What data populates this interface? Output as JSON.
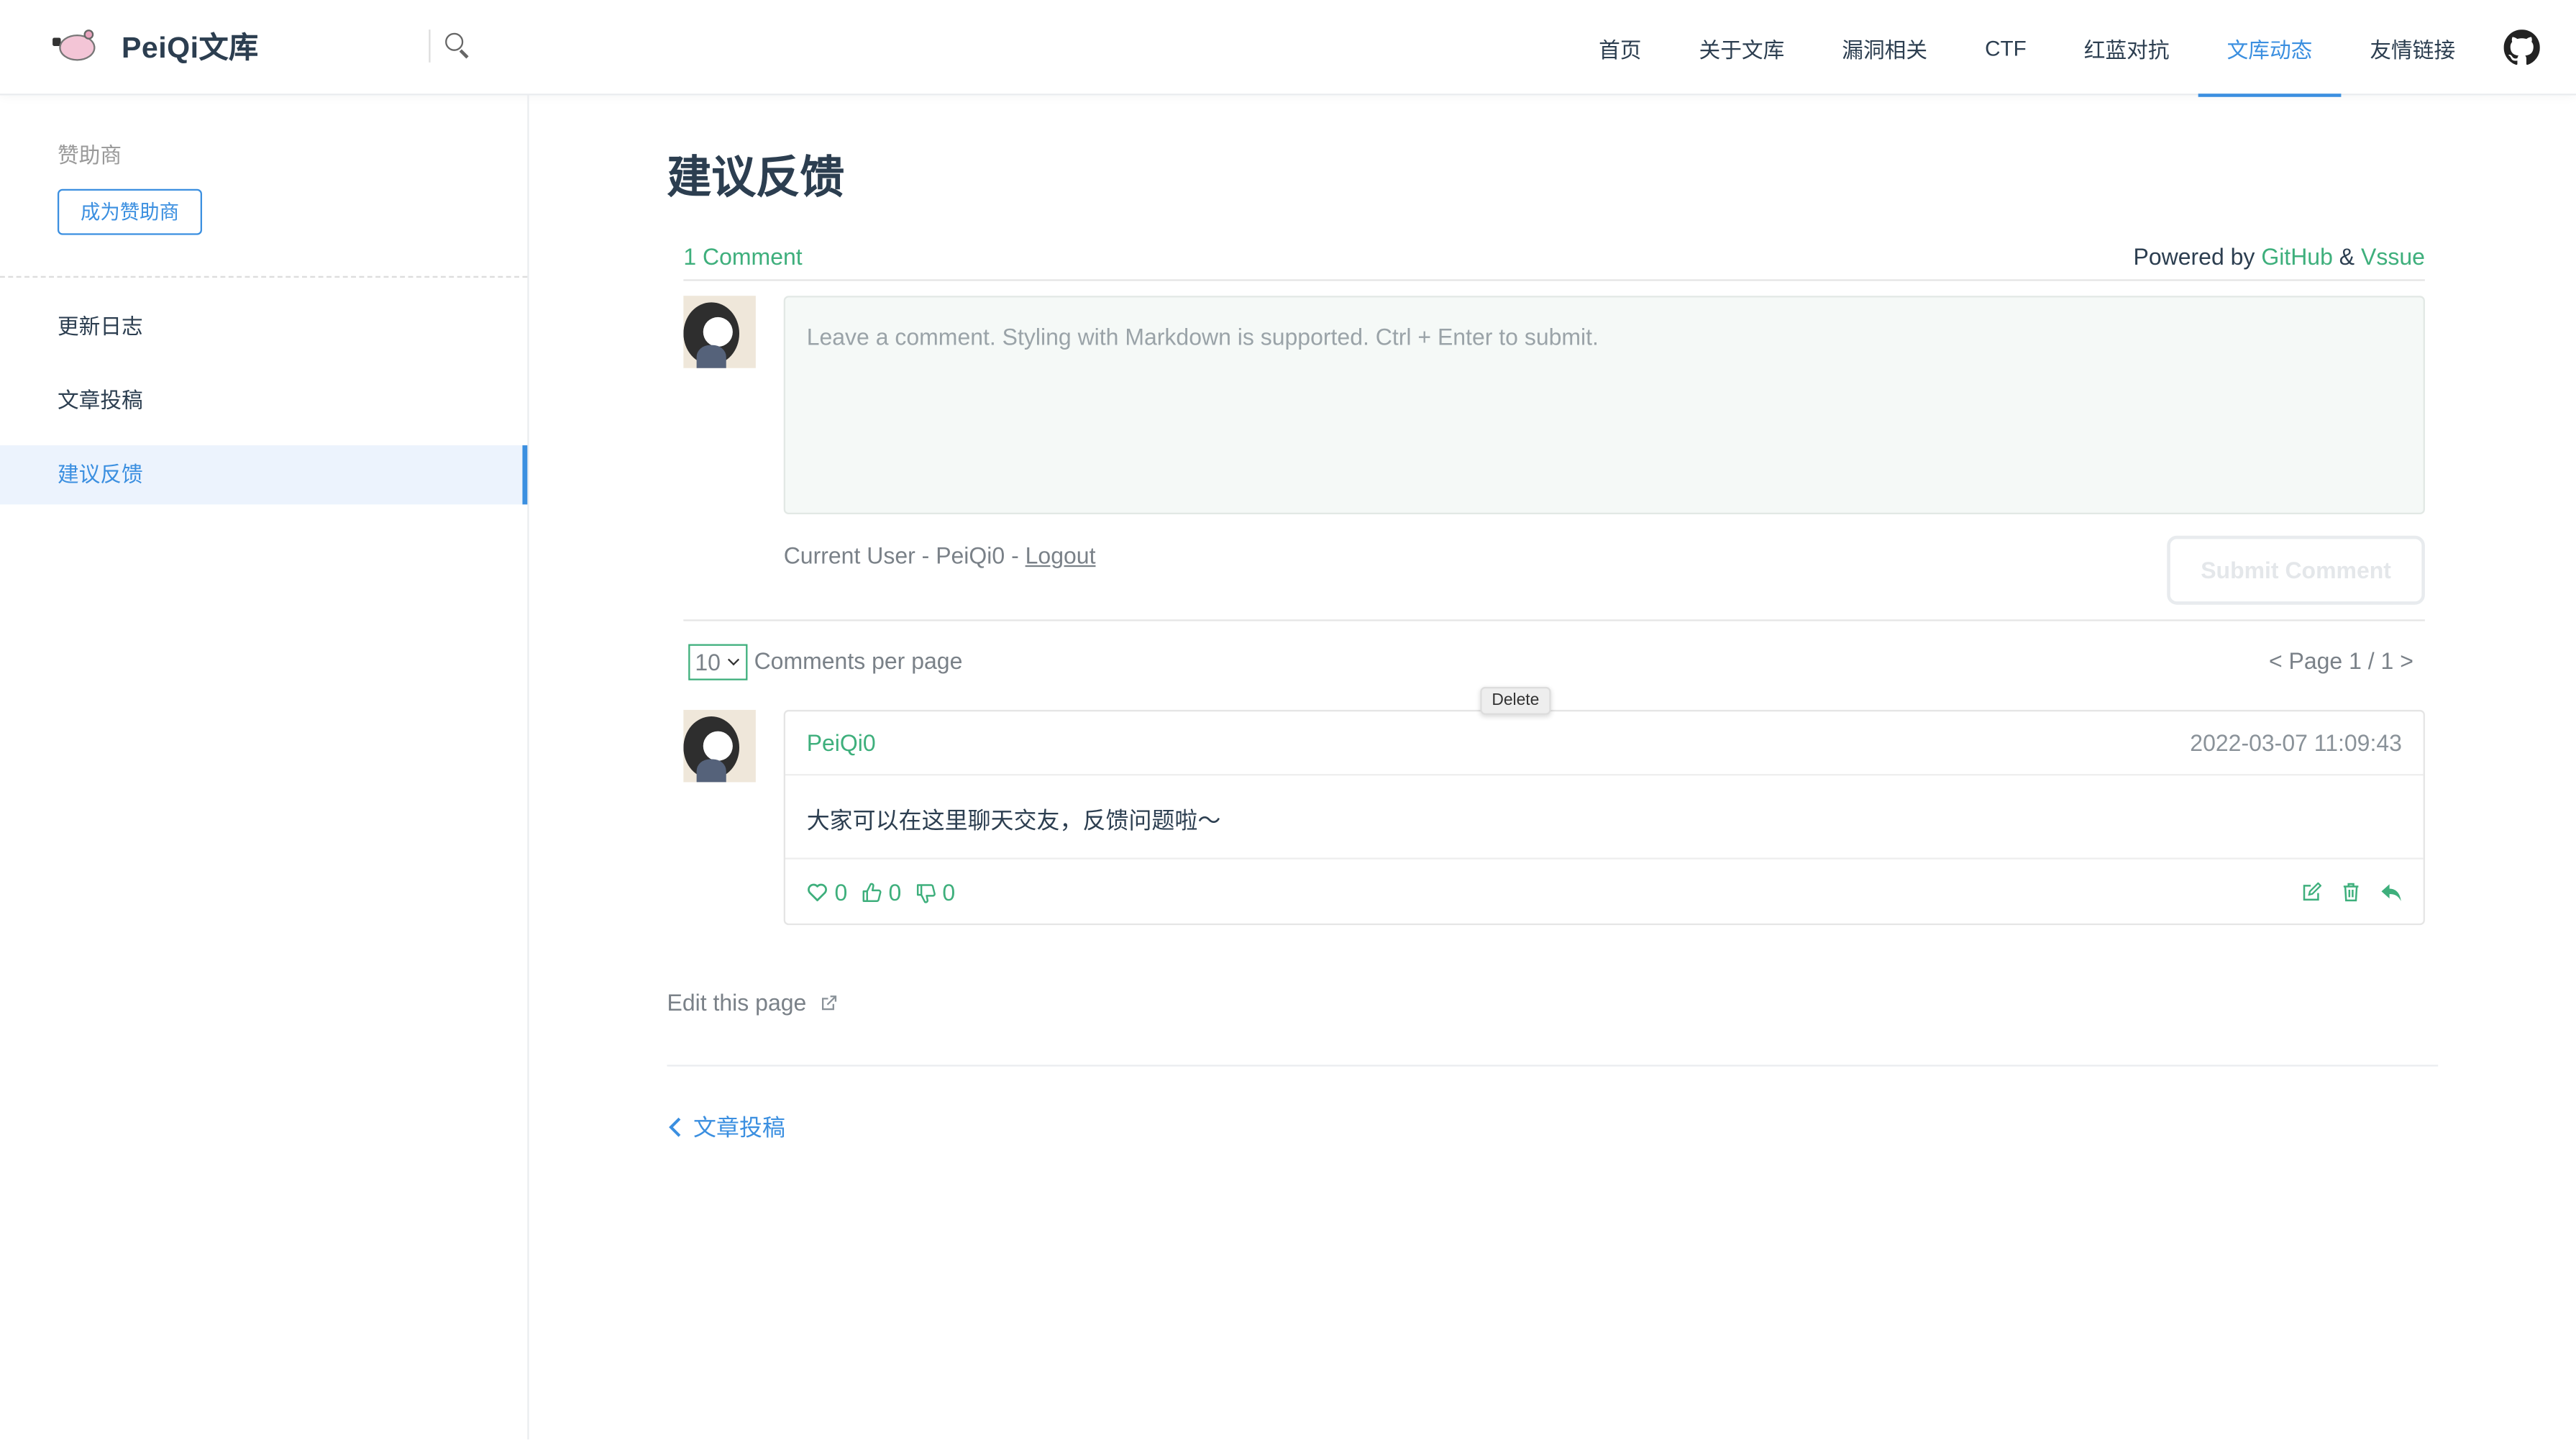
{
  "navbar": {
    "brand": "PeiQi文库",
    "items": [
      "首页",
      "关于文库",
      "漏洞相关",
      "CTF",
      "红蓝对抗",
      "文库动态",
      "友情链接"
    ],
    "active_index": 5
  },
  "sidebar": {
    "sponsor_label": "赞助商",
    "sponsor_button": "成为赞助商",
    "items": [
      "更新日志",
      "文章投稿",
      "建议反馈"
    ],
    "active_index": 2
  },
  "page": {
    "title": "建议反馈",
    "edit_link": "Edit this page",
    "prev_link": "文章投稿"
  },
  "vssue": {
    "comment_count": "1 Comment",
    "powered_prefix": "Powered by",
    "powered_github": "GitHub",
    "powered_amp": "&",
    "powered_vssue": "Vssue",
    "textarea_placeholder": "Leave a comment. Styling with Markdown is supported. Ctrl + Enter to submit.",
    "current_user_prefix": "Current User - PeiQi0 -",
    "logout": "Logout",
    "submit": "Submit Comment",
    "per_page_value": "10",
    "per_page_label": "Comments per page",
    "page_info": "<  Page 1 / 1  >",
    "tooltip": "Delete"
  },
  "comment": {
    "author": "PeiQi0",
    "time": "2022-03-07 11:09:43",
    "body": "大家可以在这里聊天交友，反馈问题啦～",
    "hearts": "0",
    "likes": "0",
    "dislikes": "0"
  },
  "colors": {
    "accent_green": "#3eaf7c",
    "accent_blue": "#3b8fe0"
  }
}
